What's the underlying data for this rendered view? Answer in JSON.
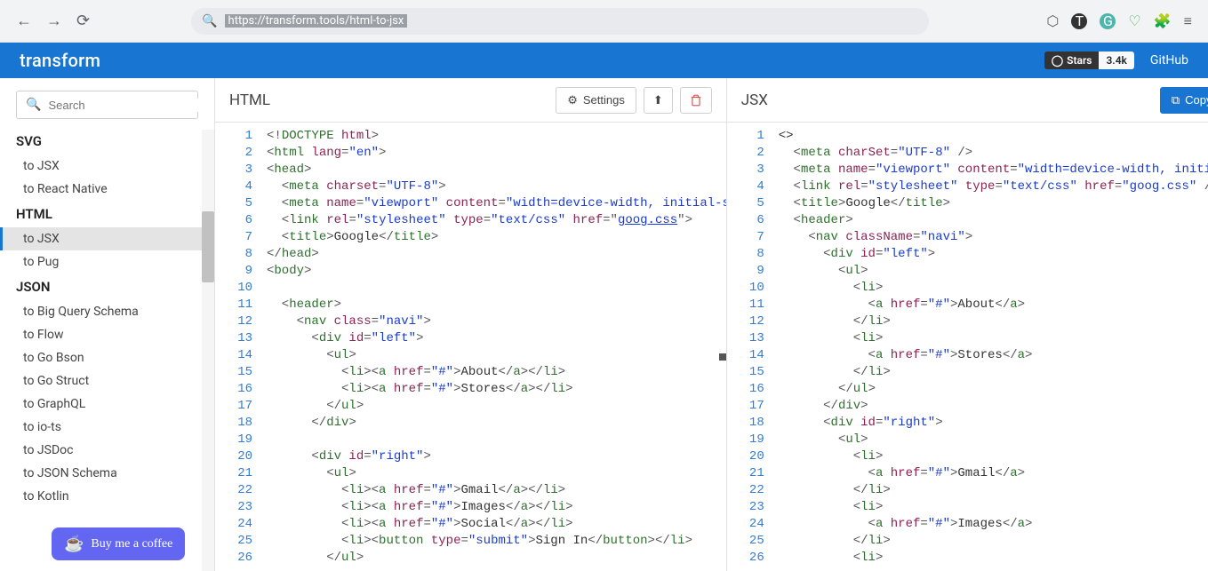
{
  "browser": {
    "url": "https://transform.tools/html-to-jsx"
  },
  "app": {
    "logo": "transform",
    "stars_label": "Stars",
    "stars_count": "3.4k",
    "github_label": "GitHub"
  },
  "sidebar": {
    "search_placeholder": "Search",
    "sections": [
      {
        "heading": "SVG",
        "items": [
          "to JSX",
          "to React Native"
        ]
      },
      {
        "heading": "HTML",
        "items": [
          "to JSX",
          "to Pug"
        ],
        "active_index": 0
      },
      {
        "heading": "JSON",
        "items": [
          "to Big Query Schema",
          "to Flow",
          "to Go Bson",
          "to Go Struct",
          "to GraphQL",
          "to io-ts",
          "to JSDoc",
          "to JSON Schema",
          "to Kotlin"
        ]
      }
    ],
    "coffee": "Buy me a coffee"
  },
  "left_pane": {
    "title": "HTML",
    "settings_label": "Settings",
    "code_lines": [
      [
        [
          "punct",
          "<!"
        ],
        [
          "tag",
          "DOCTYPE "
        ],
        [
          "attr",
          "html"
        ],
        [
          "punct",
          ">"
        ]
      ],
      [
        [
          "punct",
          "<"
        ],
        [
          "tag",
          "html "
        ],
        [
          "attr",
          "lang"
        ],
        [
          "punct",
          "="
        ],
        [
          "str",
          "\"en\""
        ],
        [
          "punct",
          ">"
        ]
      ],
      [
        [
          "punct",
          "<"
        ],
        [
          "tag",
          "head"
        ],
        [
          "punct",
          ">"
        ]
      ],
      [
        [
          "punct",
          "  <"
        ],
        [
          "tag",
          "meta "
        ],
        [
          "attr",
          "charset"
        ],
        [
          "punct",
          "="
        ],
        [
          "str",
          "\"UTF-8\""
        ],
        [
          "punct",
          ">"
        ]
      ],
      [
        [
          "punct",
          "  <"
        ],
        [
          "tag",
          "meta "
        ],
        [
          "attr",
          "name"
        ],
        [
          "punct",
          "="
        ],
        [
          "str",
          "\"viewport\""
        ],
        [
          "punct",
          " "
        ],
        [
          "attr",
          "content"
        ],
        [
          "punct",
          "="
        ],
        [
          "str",
          "\"width=device-width, initial-s"
        ]
      ],
      [
        [
          "punct",
          "  <"
        ],
        [
          "tag",
          "link "
        ],
        [
          "attr",
          "rel"
        ],
        [
          "punct",
          "="
        ],
        [
          "str",
          "\"stylesheet\""
        ],
        [
          "punct",
          " "
        ],
        [
          "attr",
          "type"
        ],
        [
          "punct",
          "="
        ],
        [
          "str",
          "\"text/css\""
        ],
        [
          "punct",
          " "
        ],
        [
          "attr",
          "href"
        ],
        [
          "punct",
          "=\""
        ],
        [
          "link",
          "goog.css"
        ],
        [
          "punct",
          "\">"
        ]
      ],
      [
        [
          "punct",
          "  <"
        ],
        [
          "tag",
          "title"
        ],
        [
          "punct",
          ">"
        ],
        [
          "text",
          "Google"
        ],
        [
          "punct",
          "</"
        ],
        [
          "tag",
          "title"
        ],
        [
          "punct",
          ">"
        ]
      ],
      [
        [
          "punct",
          "</"
        ],
        [
          "tag",
          "head"
        ],
        [
          "punct",
          ">"
        ]
      ],
      [
        [
          "punct",
          "<"
        ],
        [
          "tag",
          "body"
        ],
        [
          "punct",
          ">"
        ]
      ],
      [],
      [
        [
          "punct",
          "  <"
        ],
        [
          "tag",
          "header"
        ],
        [
          "punct",
          ">"
        ]
      ],
      [
        [
          "punct",
          "    <"
        ],
        [
          "tag",
          "nav "
        ],
        [
          "attr",
          "class"
        ],
        [
          "punct",
          "="
        ],
        [
          "str",
          "\"navi\""
        ],
        [
          "punct",
          ">"
        ]
      ],
      [
        [
          "punct",
          "      <"
        ],
        [
          "tag",
          "div "
        ],
        [
          "attr",
          "id"
        ],
        [
          "punct",
          "="
        ],
        [
          "str",
          "\"left\""
        ],
        [
          "punct",
          ">"
        ]
      ],
      [
        [
          "punct",
          "        <"
        ],
        [
          "tag",
          "ul"
        ],
        [
          "punct",
          ">"
        ]
      ],
      [
        [
          "punct",
          "          <"
        ],
        [
          "tag",
          "li"
        ],
        [
          "punct",
          "><"
        ],
        [
          "tag",
          "a "
        ],
        [
          "attr",
          "href"
        ],
        [
          "punct",
          "="
        ],
        [
          "str",
          "\"#\""
        ],
        [
          "punct",
          ">"
        ],
        [
          "text",
          "About"
        ],
        [
          "punct",
          "</"
        ],
        [
          "tag",
          "a"
        ],
        [
          "punct",
          "></"
        ],
        [
          "tag",
          "li"
        ],
        [
          "punct",
          ">"
        ]
      ],
      [
        [
          "punct",
          "          <"
        ],
        [
          "tag",
          "li"
        ],
        [
          "punct",
          "><"
        ],
        [
          "tag",
          "a "
        ],
        [
          "attr",
          "href"
        ],
        [
          "punct",
          "="
        ],
        [
          "str",
          "\"#\""
        ],
        [
          "punct",
          ">"
        ],
        [
          "text",
          "Stores"
        ],
        [
          "punct",
          "</"
        ],
        [
          "tag",
          "a"
        ],
        [
          "punct",
          "></"
        ],
        [
          "tag",
          "li"
        ],
        [
          "punct",
          ">"
        ]
      ],
      [
        [
          "punct",
          "        </"
        ],
        [
          "tag",
          "ul"
        ],
        [
          "punct",
          ">"
        ]
      ],
      [
        [
          "punct",
          "      </"
        ],
        [
          "tag",
          "div"
        ],
        [
          "punct",
          ">"
        ]
      ],
      [],
      [
        [
          "punct",
          "      <"
        ],
        [
          "tag",
          "div "
        ],
        [
          "attr",
          "id"
        ],
        [
          "punct",
          "="
        ],
        [
          "str",
          "\"right\""
        ],
        [
          "punct",
          ">"
        ]
      ],
      [
        [
          "punct",
          "        <"
        ],
        [
          "tag",
          "ul"
        ],
        [
          "punct",
          ">"
        ]
      ],
      [
        [
          "punct",
          "          <"
        ],
        [
          "tag",
          "li"
        ],
        [
          "punct",
          "><"
        ],
        [
          "tag",
          "a "
        ],
        [
          "attr",
          "href"
        ],
        [
          "punct",
          "="
        ],
        [
          "str",
          "\"#\""
        ],
        [
          "punct",
          ">"
        ],
        [
          "text",
          "Gmail"
        ],
        [
          "punct",
          "</"
        ],
        [
          "tag",
          "a"
        ],
        [
          "punct",
          "></"
        ],
        [
          "tag",
          "li"
        ],
        [
          "punct",
          ">"
        ]
      ],
      [
        [
          "punct",
          "          <"
        ],
        [
          "tag",
          "li"
        ],
        [
          "punct",
          "><"
        ],
        [
          "tag",
          "a "
        ],
        [
          "attr",
          "href"
        ],
        [
          "punct",
          "="
        ],
        [
          "str",
          "\"#\""
        ],
        [
          "punct",
          ">"
        ],
        [
          "text",
          "Images"
        ],
        [
          "punct",
          "</"
        ],
        [
          "tag",
          "a"
        ],
        [
          "punct",
          "></"
        ],
        [
          "tag",
          "li"
        ],
        [
          "punct",
          ">"
        ]
      ],
      [
        [
          "punct",
          "          <"
        ],
        [
          "tag",
          "li"
        ],
        [
          "punct",
          "><"
        ],
        [
          "tag",
          "a "
        ],
        [
          "attr",
          "href"
        ],
        [
          "punct",
          "="
        ],
        [
          "str",
          "\"#\""
        ],
        [
          "punct",
          ">"
        ],
        [
          "text",
          "Social"
        ],
        [
          "punct",
          "</"
        ],
        [
          "tag",
          "a"
        ],
        [
          "punct",
          "></"
        ],
        [
          "tag",
          "li"
        ],
        [
          "punct",
          ">"
        ]
      ],
      [
        [
          "punct",
          "          <"
        ],
        [
          "tag",
          "li"
        ],
        [
          "punct",
          "><"
        ],
        [
          "tag",
          "button "
        ],
        [
          "attr",
          "type"
        ],
        [
          "punct",
          "="
        ],
        [
          "str",
          "\"submit\""
        ],
        [
          "punct",
          ">"
        ],
        [
          "text",
          "Sign In"
        ],
        [
          "punct",
          "</"
        ],
        [
          "tag",
          "button"
        ],
        [
          "punct",
          "></"
        ],
        [
          "tag",
          "li"
        ],
        [
          "punct",
          ">"
        ]
      ],
      [
        [
          "punct",
          "        </"
        ],
        [
          "tag",
          "ul"
        ],
        [
          "punct",
          ">"
        ]
      ]
    ]
  },
  "right_pane": {
    "title": "JSX",
    "copy_label": "Copy",
    "code_lines": [
      [
        [
          "frag",
          "<>"
        ]
      ],
      [
        [
          "punct",
          "  <"
        ],
        [
          "tag",
          "meta "
        ],
        [
          "attr",
          "charSet"
        ],
        [
          "punct",
          "="
        ],
        [
          "str",
          "\"UTF-8\""
        ],
        [
          "punct",
          " />"
        ]
      ],
      [
        [
          "punct",
          "  <"
        ],
        [
          "tag",
          "meta "
        ],
        [
          "attr",
          "name"
        ],
        [
          "punct",
          "="
        ],
        [
          "str",
          "\"viewport\""
        ],
        [
          "punct",
          " "
        ],
        [
          "attr",
          "content"
        ],
        [
          "punct",
          "="
        ],
        [
          "str",
          "\"width=device-width, initial-"
        ]
      ],
      [
        [
          "punct",
          "  <"
        ],
        [
          "tag",
          "link "
        ],
        [
          "attr",
          "rel"
        ],
        [
          "punct",
          "="
        ],
        [
          "str",
          "\"stylesheet\""
        ],
        [
          "punct",
          " "
        ],
        [
          "attr",
          "type"
        ],
        [
          "punct",
          "="
        ],
        [
          "str",
          "\"text/css\""
        ],
        [
          "punct",
          " "
        ],
        [
          "attr",
          "href"
        ],
        [
          "punct",
          "="
        ],
        [
          "str",
          "\"goog.css\""
        ],
        [
          "punct",
          " />"
        ]
      ],
      [
        [
          "punct",
          "  <"
        ],
        [
          "tag",
          "title"
        ],
        [
          "punct",
          ">"
        ],
        [
          "text",
          "Google"
        ],
        [
          "punct",
          "</"
        ],
        [
          "tag",
          "title"
        ],
        [
          "punct",
          ">"
        ]
      ],
      [
        [
          "punct",
          "  <"
        ],
        [
          "tag",
          "header"
        ],
        [
          "punct",
          ">"
        ]
      ],
      [
        [
          "punct",
          "    <"
        ],
        [
          "tag",
          "nav "
        ],
        [
          "attr",
          "className"
        ],
        [
          "punct",
          "="
        ],
        [
          "str",
          "\"navi\""
        ],
        [
          "punct",
          ">"
        ]
      ],
      [
        [
          "punct",
          "      <"
        ],
        [
          "tag",
          "div "
        ],
        [
          "attr",
          "id"
        ],
        [
          "punct",
          "="
        ],
        [
          "str",
          "\"left\""
        ],
        [
          "punct",
          ">"
        ]
      ],
      [
        [
          "punct",
          "        <"
        ],
        [
          "tag",
          "ul"
        ],
        [
          "punct",
          ">"
        ]
      ],
      [
        [
          "punct",
          "          <"
        ],
        [
          "tag",
          "li"
        ],
        [
          "punct",
          ">"
        ]
      ],
      [
        [
          "punct",
          "            <"
        ],
        [
          "tag",
          "a "
        ],
        [
          "attr",
          "href"
        ],
        [
          "punct",
          "="
        ],
        [
          "str",
          "\"#\""
        ],
        [
          "punct",
          ">"
        ],
        [
          "text",
          "About"
        ],
        [
          "punct",
          "</"
        ],
        [
          "tag",
          "a"
        ],
        [
          "punct",
          ">"
        ]
      ],
      [
        [
          "punct",
          "          </"
        ],
        [
          "tag",
          "li"
        ],
        [
          "punct",
          ">"
        ]
      ],
      [
        [
          "punct",
          "          <"
        ],
        [
          "tag",
          "li"
        ],
        [
          "punct",
          ">"
        ]
      ],
      [
        [
          "punct",
          "            <"
        ],
        [
          "tag",
          "a "
        ],
        [
          "attr",
          "href"
        ],
        [
          "punct",
          "="
        ],
        [
          "str",
          "\"#\""
        ],
        [
          "punct",
          ">"
        ],
        [
          "text",
          "Stores"
        ],
        [
          "punct",
          "</"
        ],
        [
          "tag",
          "a"
        ],
        [
          "punct",
          ">"
        ]
      ],
      [
        [
          "punct",
          "          </"
        ],
        [
          "tag",
          "li"
        ],
        [
          "punct",
          ">"
        ]
      ],
      [
        [
          "punct",
          "        </"
        ],
        [
          "tag",
          "ul"
        ],
        [
          "punct",
          ">"
        ]
      ],
      [
        [
          "punct",
          "      </"
        ],
        [
          "tag",
          "div"
        ],
        [
          "punct",
          ">"
        ]
      ],
      [
        [
          "punct",
          "      <"
        ],
        [
          "tag",
          "div "
        ],
        [
          "attr",
          "id"
        ],
        [
          "punct",
          "="
        ],
        [
          "str",
          "\"right\""
        ],
        [
          "punct",
          ">"
        ]
      ],
      [
        [
          "punct",
          "        <"
        ],
        [
          "tag",
          "ul"
        ],
        [
          "punct",
          ">"
        ]
      ],
      [
        [
          "punct",
          "          <"
        ],
        [
          "tag",
          "li"
        ],
        [
          "punct",
          ">"
        ]
      ],
      [
        [
          "punct",
          "            <"
        ],
        [
          "tag",
          "a "
        ],
        [
          "attr",
          "href"
        ],
        [
          "punct",
          "="
        ],
        [
          "str",
          "\"#\""
        ],
        [
          "punct",
          ">"
        ],
        [
          "text",
          "Gmail"
        ],
        [
          "punct",
          "</"
        ],
        [
          "tag",
          "a"
        ],
        [
          "punct",
          ">"
        ]
      ],
      [
        [
          "punct",
          "          </"
        ],
        [
          "tag",
          "li"
        ],
        [
          "punct",
          ">"
        ]
      ],
      [
        [
          "punct",
          "          <"
        ],
        [
          "tag",
          "li"
        ],
        [
          "punct",
          ">"
        ]
      ],
      [
        [
          "punct",
          "            <"
        ],
        [
          "tag",
          "a "
        ],
        [
          "attr",
          "href"
        ],
        [
          "punct",
          "="
        ],
        [
          "str",
          "\"#\""
        ],
        [
          "punct",
          ">"
        ],
        [
          "text",
          "Images"
        ],
        [
          "punct",
          "</"
        ],
        [
          "tag",
          "a"
        ],
        [
          "punct",
          ">"
        ]
      ],
      [
        [
          "punct",
          "          </"
        ],
        [
          "tag",
          "li"
        ],
        [
          "punct",
          ">"
        ]
      ],
      [
        [
          "punct",
          "          <"
        ],
        [
          "tag",
          "li"
        ],
        [
          "punct",
          ">"
        ]
      ]
    ]
  }
}
